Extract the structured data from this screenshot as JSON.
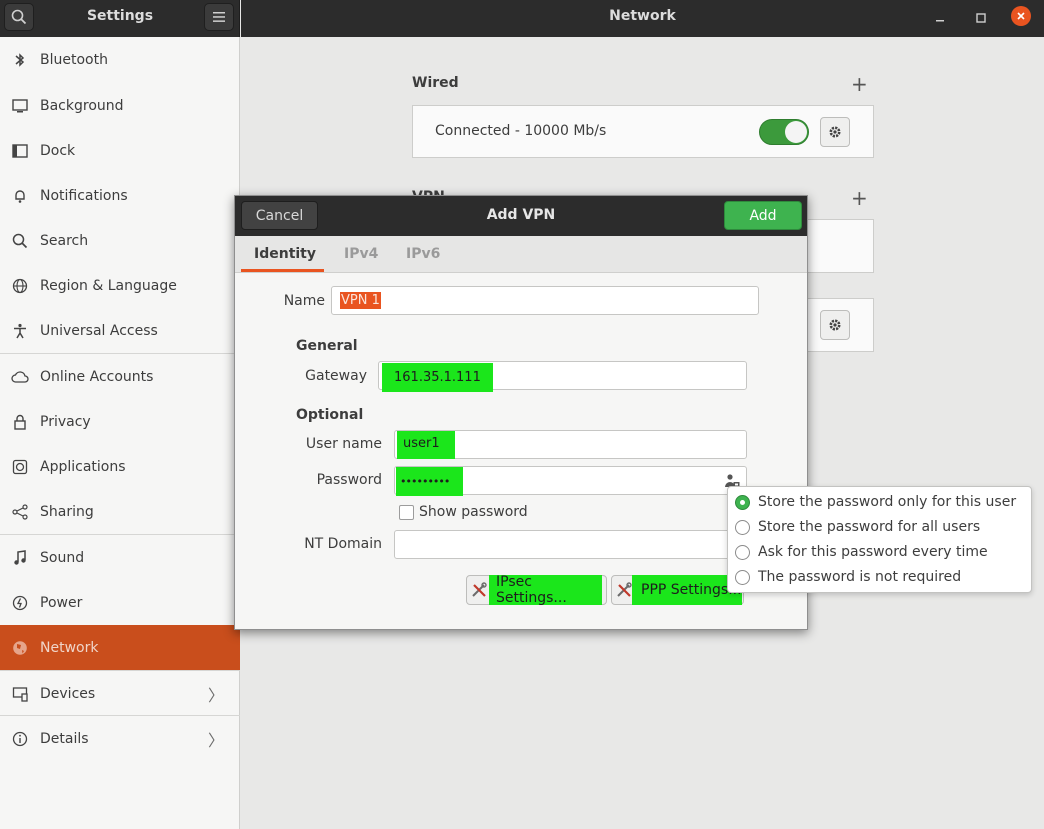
{
  "header": {
    "sidebar_title": "Settings",
    "main_title": "Network",
    "search_icon": "search-icon",
    "menu_icon": "hamburger-menu-icon"
  },
  "sidebar": {
    "items": [
      {
        "label": "Bluetooth",
        "icon": "bluetooth-icon"
      },
      {
        "label": "Background",
        "icon": "background-icon"
      },
      {
        "label": "Dock",
        "icon": "dock-icon"
      },
      {
        "label": "Notifications",
        "icon": "bell-icon"
      },
      {
        "label": "Search",
        "icon": "search-icon"
      },
      {
        "label": "Region & Language",
        "icon": "globe-icon"
      },
      {
        "label": "Universal Access",
        "icon": "accessibility-icon"
      },
      {
        "label": "Online Accounts",
        "icon": "cloud-icon"
      },
      {
        "label": "Privacy",
        "icon": "lock-icon"
      },
      {
        "label": "Applications",
        "icon": "applications-icon"
      },
      {
        "label": "Sharing",
        "icon": "share-icon"
      },
      {
        "label": "Sound",
        "icon": "music-note-icon"
      },
      {
        "label": "Power",
        "icon": "power-icon"
      },
      {
        "label": "Network",
        "icon": "network-icon",
        "active": true
      },
      {
        "label": "Devices",
        "icon": "devices-icon"
      },
      {
        "label": "Details",
        "icon": "info-icon"
      }
    ]
  },
  "main": {
    "wired": {
      "title": "Wired",
      "status": "Connected - 10000 Mb/s",
      "toggle_on": true
    },
    "vpn": {
      "title": "VPN"
    }
  },
  "dialog": {
    "title": "Add VPN",
    "cancel_label": "Cancel",
    "add_label": "Add",
    "tabs": [
      "Identity",
      "IPv4",
      "IPv6"
    ],
    "name_label": "Name",
    "name_value": "VPN 1",
    "general_title": "General",
    "gateway_label": "Gateway",
    "gateway_value": "161.35.1.111",
    "optional_title": "Optional",
    "username_label": "User name",
    "username_value": "user1",
    "password_label": "Password",
    "password_value": "•••••••••",
    "show_password_label": "Show password",
    "ntdomain_label": "NT Domain",
    "ntdomain_value": "",
    "ipsec_label": "IPsec Settings...",
    "ppp_label": "PPP Settings..."
  },
  "password_popover": {
    "options": [
      {
        "label": "Store the password only for this user",
        "selected": true
      },
      {
        "label": "Store the password for all users",
        "selected": false
      },
      {
        "label": "Ask for this password every time",
        "selected": false
      },
      {
        "label": "The password is not required",
        "selected": false
      }
    ]
  },
  "colors": {
    "accent": "#e95420",
    "add_button": "#3eb34f",
    "highlight": "#1be61b",
    "header_bg": "#2c2c2c"
  }
}
